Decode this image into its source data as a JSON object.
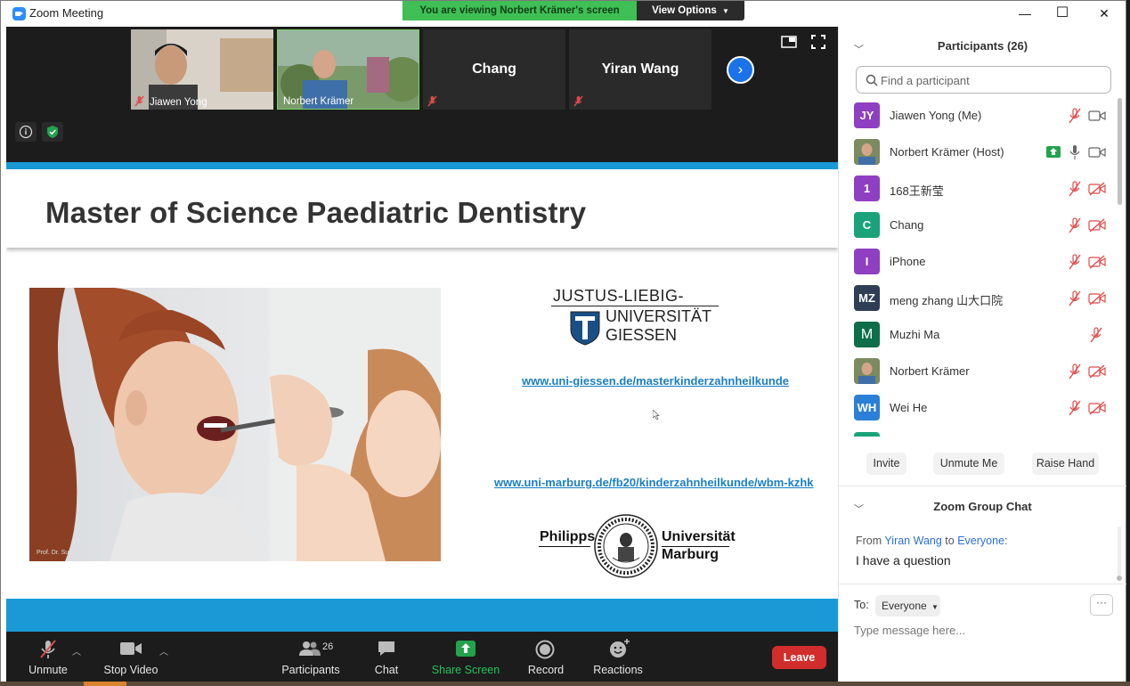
{
  "window": {
    "title": "Zoom Meeting",
    "viewing_banner": "You are viewing Norbert Krämer's screen",
    "view_options": "View Options",
    "minimize": "—",
    "maximize": "☐",
    "close": "✕"
  },
  "video_strip": {
    "tiles": [
      {
        "name": "Jiawen Yong"
      },
      {
        "name": "Norbert Krämer"
      },
      {
        "name": "Chang"
      },
      {
        "name": "Yiran Wang"
      }
    ],
    "next": "›"
  },
  "slide": {
    "title": "Master of Science Paediatric Dentistry",
    "photo_credit": "Prof. Dr. Susanne Lücker",
    "jlu": {
      "line1": "JUSTUS-LIEBIG-",
      "line2": "UNIVERSITÄT",
      "line3": "GIESSEN"
    },
    "link1": "www.uni-giessen.de/masterkinderzahnheilkunde",
    "link2": "www.uni-marburg.de/fb20/kinderzahnheilkunde/wbm-kzhk",
    "marburg": {
      "left": "Philipps",
      "right1": "Universität",
      "right2": "Marburg"
    }
  },
  "toolbar": {
    "unmute": "Unmute",
    "stop_video": "Stop Video",
    "participants": "Participants",
    "participants_count": "26",
    "chat": "Chat",
    "share_screen": "Share Screen",
    "record": "Record",
    "reactions": "Reactions",
    "leave": "Leave"
  },
  "participants_panel": {
    "title": "Participants (26)",
    "search_placeholder": "Find a participant",
    "participants": [
      {
        "initials": "JY",
        "name": "Jiawen Yong (Me)",
        "color": "#8e3fc2"
      },
      {
        "initials": "",
        "name": "Norbert Krämer (Host)",
        "color": "#6a7a5a"
      },
      {
        "initials": "1",
        "name": "168王新莹",
        "color": "#8e3fc2"
      },
      {
        "initials": "C",
        "name": "Chang",
        "color": "#1aa37a"
      },
      {
        "initials": "I",
        "name": "iPhone",
        "color": "#8e3fc2"
      },
      {
        "initials": "MZ",
        "name": "meng zhang 山大口院",
        "color": "#2f3e55"
      },
      {
        "initials": "M",
        "name": "Muzhi Ma",
        "color": "#0e6e4a"
      },
      {
        "initials": "",
        "name": "Norbert Krämer",
        "color": "#6a7a5a"
      },
      {
        "initials": "WH",
        "name": "Wei He",
        "color": "#2b7fd6"
      }
    ],
    "invite": "Invite",
    "unmute_me": "Unmute Me",
    "raise_hand": "Raise Hand"
  },
  "chat_panel": {
    "title": "Zoom Group Chat",
    "from_label": "From",
    "from_name": "Yiran Wang",
    "to_word": "to",
    "to_name": "Everyone",
    "message": "I have a question",
    "to_label": "To:",
    "recipient": "Everyone",
    "more": "···",
    "input_placeholder": "Type message here..."
  }
}
